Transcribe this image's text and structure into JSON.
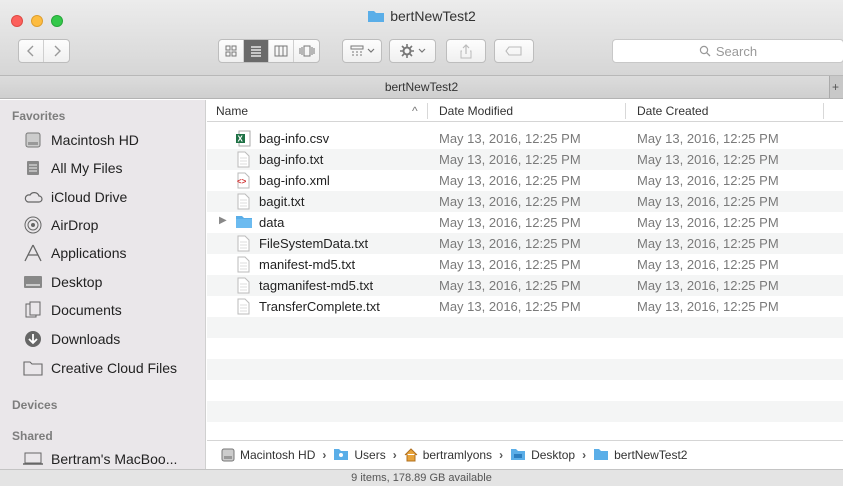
{
  "window": {
    "title": "bertNewTest2"
  },
  "toolbar": {
    "search_placeholder": "Search"
  },
  "tabbar": {
    "title": "bertNewTest2"
  },
  "sidebar": {
    "favorites_header": "Favorites",
    "favorites": [
      {
        "label": "Macintosh HD",
        "icon": "hard-drive-icon"
      },
      {
        "label": "All My Files",
        "icon": "all-files-icon"
      },
      {
        "label": "iCloud Drive",
        "icon": "cloud-icon"
      },
      {
        "label": "AirDrop",
        "icon": "airdrop-icon"
      },
      {
        "label": "Applications",
        "icon": "applications-icon"
      },
      {
        "label": "Desktop",
        "icon": "desktop-icon"
      },
      {
        "label": "Documents",
        "icon": "documents-icon"
      },
      {
        "label": "Downloads",
        "icon": "downloads-icon"
      },
      {
        "label": "Creative Cloud Files",
        "icon": "folder-icon"
      }
    ],
    "devices_header": "Devices",
    "shared_header": "Shared",
    "shared": [
      {
        "label": "Bertram's MacBoo...",
        "icon": "laptop-icon"
      }
    ]
  },
  "columns": {
    "name": "Name",
    "modified": "Date Modified",
    "created": "Date Created"
  },
  "files": [
    {
      "name": "bag-info.csv",
      "modified": "May 13, 2016, 12:25 PM",
      "created": "May 13, 2016, 12:25 PM",
      "icon": "excel-file-icon"
    },
    {
      "name": "bag-info.txt",
      "modified": "May 13, 2016, 12:25 PM",
      "created": "May 13, 2016, 12:25 PM",
      "icon": "text-file-icon"
    },
    {
      "name": "bag-info.xml",
      "modified": "May 13, 2016, 12:25 PM",
      "created": "May 13, 2016, 12:25 PM",
      "icon": "xml-file-icon"
    },
    {
      "name": "bagit.txt",
      "modified": "May 13, 2016, 12:25 PM",
      "created": "May 13, 2016, 12:25 PM",
      "icon": "text-file-icon"
    },
    {
      "name": "data",
      "modified": "May 13, 2016, 12:25 PM",
      "created": "May 13, 2016, 12:25 PM",
      "icon": "folder-icon"
    },
    {
      "name": "FileSystemData.txt",
      "modified": "May 13, 2016, 12:25 PM",
      "created": "May 13, 2016, 12:25 PM",
      "icon": "text-file-icon"
    },
    {
      "name": "manifest-md5.txt",
      "modified": "May 13, 2016, 12:25 PM",
      "created": "May 13, 2016, 12:25 PM",
      "icon": "text-file-icon"
    },
    {
      "name": "tagmanifest-md5.txt",
      "modified": "May 13, 2016, 12:25 PM",
      "created": "May 13, 2016, 12:25 PM",
      "icon": "text-file-icon"
    },
    {
      "name": "TransferComplete.txt",
      "modified": "May 13, 2016, 12:25 PM",
      "created": "May 13, 2016, 12:25 PM",
      "icon": "text-file-icon"
    }
  ],
  "pathbar": [
    {
      "label": "Macintosh HD",
      "icon": "hard-drive-icon"
    },
    {
      "label": "Users",
      "icon": "users-folder-icon"
    },
    {
      "label": "bertramlyons",
      "icon": "home-icon"
    },
    {
      "label": "Desktop",
      "icon": "desktop-folder-icon"
    },
    {
      "label": "bertNewTest2",
      "icon": "folder-icon"
    }
  ],
  "status": {
    "text": "9 items, 178.89 GB available"
  },
  "colors": {
    "folder_blue": "#5aaee8",
    "sidebar_bg": "#eae7ea",
    "alt_row": "#f4f5f5"
  }
}
